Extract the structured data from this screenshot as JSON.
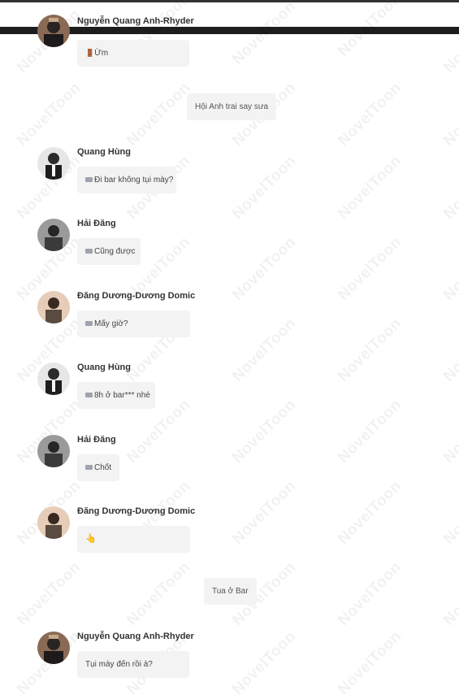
{
  "header": {
    "sender": "Nguyễn Quang Anh-Rhyder"
  },
  "watermark": "NovelToon",
  "messages": [
    {
      "type": "chat",
      "sender": "Nguyễn Quang Anh-Rhyder",
      "text": "Ừm",
      "icon": "door-emoji",
      "avatar": "avatar-rhyder",
      "show_sender": false
    },
    {
      "type": "narration",
      "text": "Hội Anh trai say sưa"
    },
    {
      "type": "chat",
      "sender": "Quang Hùng",
      "text": "Đi bar không tụi mày?",
      "icon": "chat-icon",
      "avatar": "avatar-quang-hung"
    },
    {
      "type": "chat",
      "sender": "Hải Đăng",
      "text": "Cũng được",
      "icon": "chat-icon",
      "avatar": "avatar-hai-dang"
    },
    {
      "type": "chat",
      "sender": "Đăng Dương-Dương Domic",
      "text": "Mấy giờ?",
      "icon": "chat-icon",
      "avatar": "avatar-dang-duong"
    },
    {
      "type": "chat",
      "sender": "Quang Hùng",
      "text": "8h ở bar*** nhé",
      "icon": "chat-icon",
      "avatar": "avatar-quang-hung"
    },
    {
      "type": "chat",
      "sender": "Hải Đăng",
      "text": "Chốt",
      "icon": "chat-icon",
      "avatar": "avatar-hai-dang"
    },
    {
      "type": "chat",
      "sender": "Đăng Dương-Dương Domic",
      "text": "👆",
      "icon": "pointing-up-emoji",
      "avatar": "avatar-dang-duong"
    },
    {
      "type": "narration",
      "text": "Tua ở Bar"
    },
    {
      "type": "chat",
      "sender": "Nguyễn Quang Anh-Rhyder",
      "text": "Tụi mày đến rồi à?",
      "icon": "none",
      "avatar": "avatar-rhyder"
    }
  ],
  "colors": {
    "bubble": "#f3f3f3",
    "sender_text": "#333333",
    "body_text": "#444444"
  }
}
